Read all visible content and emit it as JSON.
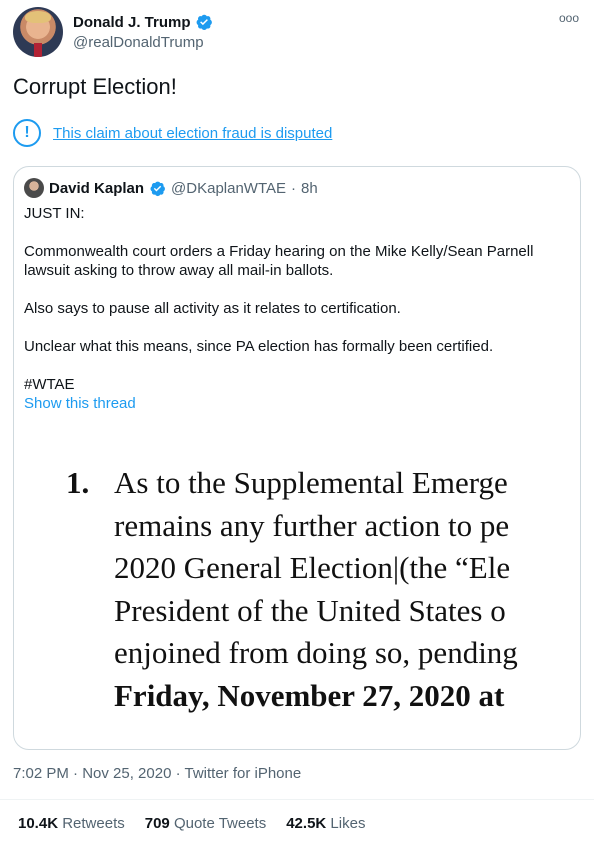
{
  "author": {
    "name": "Donald J. Trump",
    "handle": "@realDonaldTrump",
    "verified_color": "#1d9bf0"
  },
  "more_icon": "ooo",
  "tweet": {
    "text": "Corrupt Election!"
  },
  "dispute": {
    "icon": "!",
    "text": "This claim about election fraud is disputed"
  },
  "quote": {
    "name": "David Kaplan",
    "handle": "@DKaplanWTAE",
    "separator": "·",
    "time": "8h",
    "paragraphs": [
      "JUST IN:",
      "Commonwealth court orders a Friday hearing on the Mike Kelly/Sean Parnell lawsuit asking to throw away all mail-in ballots.",
      "Also says to pause all activity as it relates to certification.",
      "Unclear what this means, since PA election has formally been certified.",
      "#WTAE"
    ],
    "show_thread": "Show this thread",
    "document": {
      "number": "1.",
      "lines": [
        "As to the Supplemental Emerge",
        "remains any further action to pe",
        "2020 General Election|(the “Ele",
        "President of the United States o",
        "enjoined from doing so, pending"
      ],
      "bold_line": "Friday, November 27, 2020 at"
    }
  },
  "meta": {
    "text": "7:02 PM · Nov 25, 2020 · Twitter for iPhone"
  },
  "stats": {
    "retweets": {
      "count": "10.4K",
      "label": "Retweets"
    },
    "quotes": {
      "count": "709",
      "label": "Quote Tweets"
    },
    "likes": {
      "count": "42.5K",
      "label": "Likes"
    }
  }
}
